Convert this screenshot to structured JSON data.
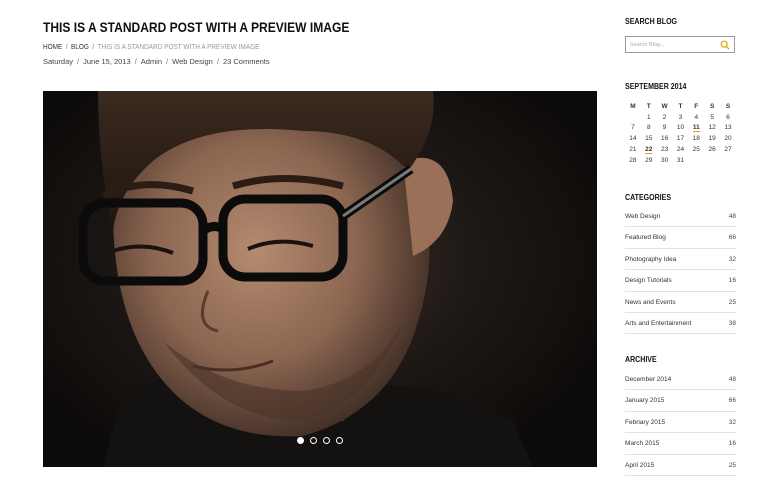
{
  "post": {
    "title": "THIS IS A STANDARD POST WITH A PREVIEW IMAGE",
    "breadcrumb": [
      "HOME",
      "BLOG",
      "THIS IS A STANDARD POST WITH A PREVIEW IMAGE"
    ],
    "meta": [
      "Saturday",
      "June 15, 2013",
      "Admin",
      "Web Design",
      "23 Comments"
    ],
    "image_alt": "Portrait of a man wearing black glasses",
    "slider_dots": 4,
    "active_dot": 0
  },
  "sidebar": {
    "search": {
      "title": "SEARCH BLOG",
      "placeholder": "Search Blog..."
    },
    "calendar": {
      "title": "SEPTEMBER 2014",
      "weekdays": [
        "M",
        "T",
        "W",
        "T",
        "F",
        "S",
        "S"
      ],
      "weeks": [
        [
          "",
          "1",
          "2",
          "3",
          "4",
          "5",
          "6"
        ],
        [
          "7",
          "8",
          "9",
          "10",
          "11",
          "12",
          "13"
        ],
        [
          "14",
          "15",
          "16",
          "17",
          "18",
          "19",
          "20"
        ],
        [
          "21",
          "22",
          "23",
          "24",
          "25",
          "26",
          "27"
        ],
        [
          "28",
          "29",
          "30",
          "31",
          "",
          "",
          ""
        ]
      ],
      "highlighted": [
        "11",
        "22"
      ],
      "highlight_color": "#e2a400"
    },
    "categories": {
      "title": "CATEGORIES",
      "items": [
        {
          "name": "Web Design",
          "count": "48"
        },
        {
          "name": "Featured Blog",
          "count": "66"
        },
        {
          "name": "Photography Idea",
          "count": "32"
        },
        {
          "name": "Design Tutorials",
          "count": "16"
        },
        {
          "name": "News and Events",
          "count": "25"
        },
        {
          "name": "Arts and Entertainment",
          "count": "38"
        }
      ]
    },
    "archive": {
      "title": "ARCHIVE",
      "items": [
        {
          "name": "December 2014",
          "count": "48"
        },
        {
          "name": "January 2015",
          "count": "66"
        },
        {
          "name": "Febriary 2015",
          "count": "32"
        },
        {
          "name": "March 2015",
          "count": "16"
        },
        {
          "name": "April 2015",
          "count": "25"
        }
      ]
    }
  }
}
